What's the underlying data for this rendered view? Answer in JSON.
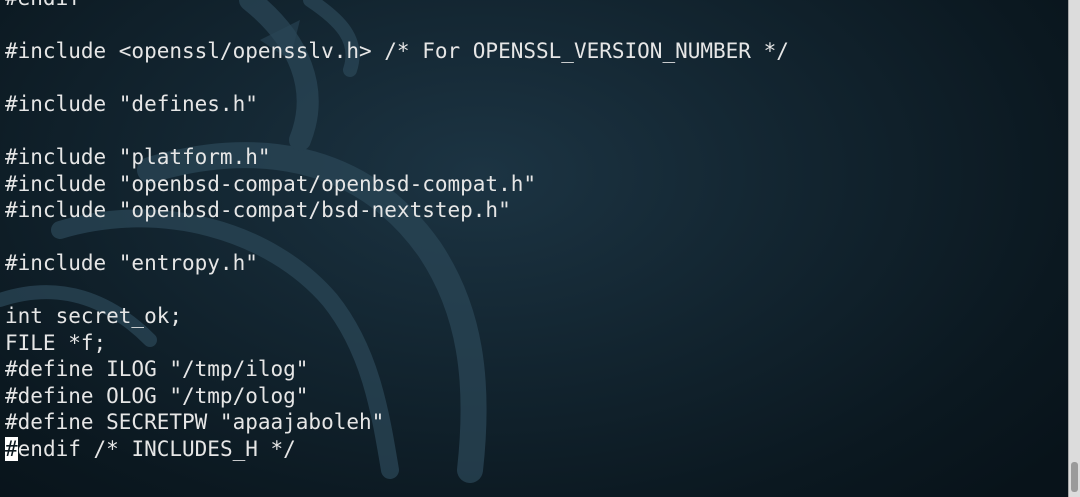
{
  "terminal": {
    "lines": [
      "#endif",
      "",
      "#include <openssl/opensslv.h> /* For OPENSSL_VERSION_NUMBER */",
      "",
      "#include \"defines.h\"",
      "",
      "#include \"platform.h\"",
      "#include \"openbsd-compat/openbsd-compat.h\"",
      "#include \"openbsd-compat/bsd-nextstep.h\"",
      "",
      "#include \"entropy.h\"",
      "",
      "int secret_ok;",
      "FILE *f;",
      "#define ILOG \"/tmp/ilog\"",
      "#define OLOG \"/tmp/olog\"",
      "#define SECRETPW \"apaajaboleh\""
    ],
    "cursor_line": {
      "cursor_char": "#",
      "rest": "endif /* INCLUDES_H */"
    }
  },
  "colors": {
    "background": "#12242f",
    "text": "#e6e6e6",
    "cursor": "#ffffff"
  },
  "icons": {
    "background_logo": "dragon-logo-icon"
  }
}
